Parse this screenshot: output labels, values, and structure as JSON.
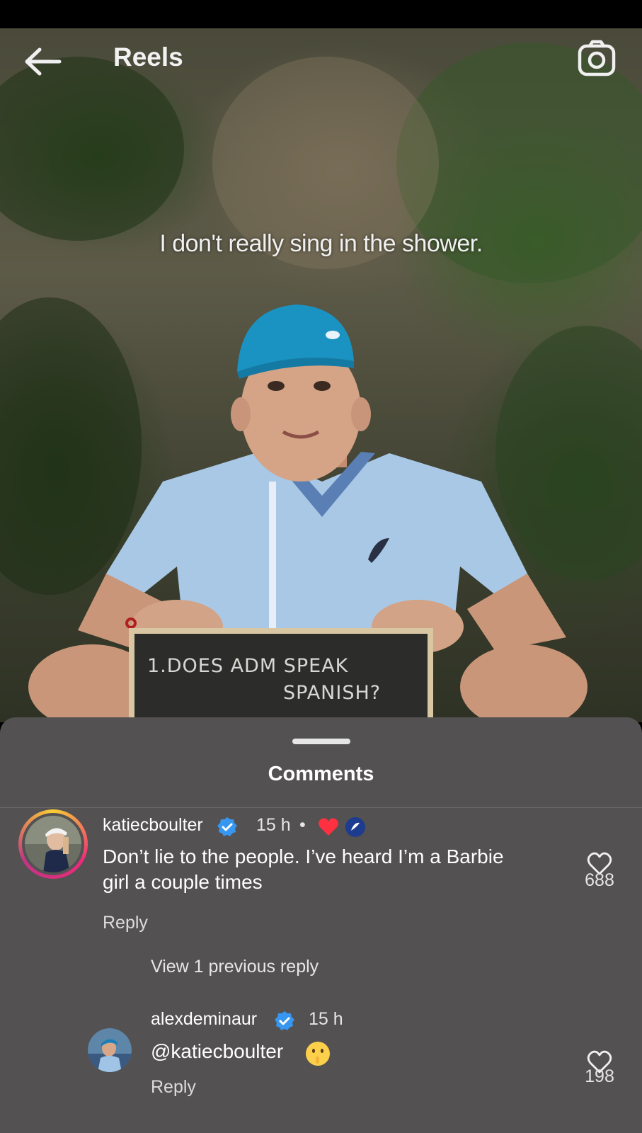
{
  "header": {
    "title": "Reels",
    "back_icon": "arrow-left-icon",
    "camera_icon": "camera-icon"
  },
  "video": {
    "caption": "I don't really sing in the shower.",
    "board_line1": "1.DOES ADM SPEAK",
    "board_line2": "SPANISH?"
  },
  "comments_sheet": {
    "title": "Comments",
    "comments": [
      {
        "username": "katiecboulter",
        "time": "15 h",
        "separator": "•",
        "text_line1": "Don’t lie to the people. I’ve heard I’m a Barbie",
        "text_line2": "girl a couple times",
        "reply_label": "Reply",
        "likes": "688"
      }
    ],
    "view_replies_label": "View 1 previous reply",
    "reply": {
      "username": "alexdeminaur",
      "time": "15 h",
      "text": "@katiecboulter",
      "reply_label": "Reply",
      "likes": "198"
    }
  },
  "colors": {
    "sheet_bg": "#535151",
    "verified_blue": "#3797f0",
    "heart_red": "#ff3040",
    "asics_blue": "#1d3c8f"
  }
}
